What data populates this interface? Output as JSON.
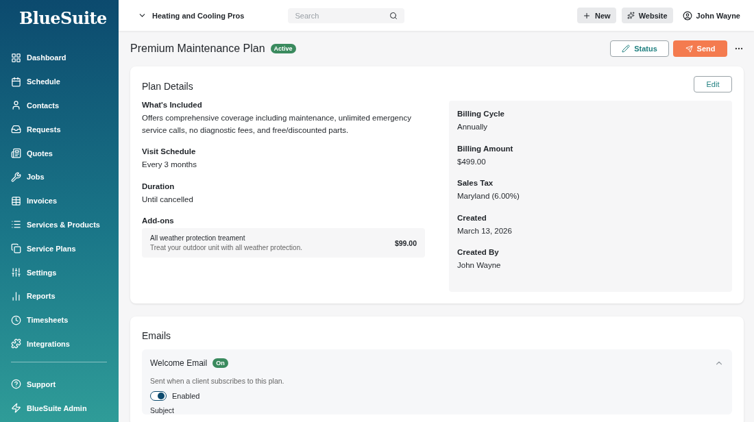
{
  "sidebar": {
    "logo": "BlueSuite",
    "items": [
      "Dashboard",
      "Schedule",
      "Contacts",
      "Requests",
      "Quotes",
      "Jobs",
      "Invoices",
      "Services & Products",
      "Service Plans",
      "Settings",
      "Reports",
      "Timesheets",
      "Integrations"
    ],
    "footer_items": [
      "Support",
      "BlueSuite Admin"
    ]
  },
  "topbar": {
    "company": "Heating and Cooling Pros",
    "search": {
      "placeholder": "Search"
    },
    "buttons": [
      "New",
      "Website"
    ],
    "user": "John Wayne"
  },
  "page": {
    "title": "Premium Maintenance Plan",
    "status": "Active",
    "actions": [
      "Status",
      "Send"
    ]
  },
  "plan_details": {
    "title": "Plan Details",
    "edit": "Edit",
    "fields": [
      {
        "label": "What's Included",
        "value": "Offers comprehensive coverage including maintenance, unlimited emergency service calls, no diagnostic fees, and free/discounted parts."
      },
      {
        "label": "Visit Schedule",
        "value": "Every 3 months"
      },
      {
        "label": "Duration",
        "value": "Until cancelled"
      }
    ],
    "addons_label": "Add-ons",
    "addons": [
      {
        "name": "All weather protection treament",
        "description": "Treat your outdoor unit with all weather protection.",
        "price": "$99.00"
      }
    ],
    "billing": [
      {
        "label": "Billing Cycle",
        "value": "Annually"
      },
      {
        "label": "Billing Amount",
        "value": "$499.00"
      },
      {
        "label": "Sales Tax",
        "value": "Maryland (6.00%)"
      },
      {
        "label": "Created",
        "value": "March 13, 2026"
      },
      {
        "label": "Created By",
        "value": "John Wayne"
      }
    ]
  },
  "emails": {
    "title": "Emails",
    "items": [
      {
        "title": "Welcome Email",
        "badge": "On",
        "expanded": true,
        "description": "Sent when a client subscribes to this plan.",
        "toggle": {
          "label": "Enabled",
          "on": true
        },
        "subject_label": "Subject"
      }
    ]
  }
}
